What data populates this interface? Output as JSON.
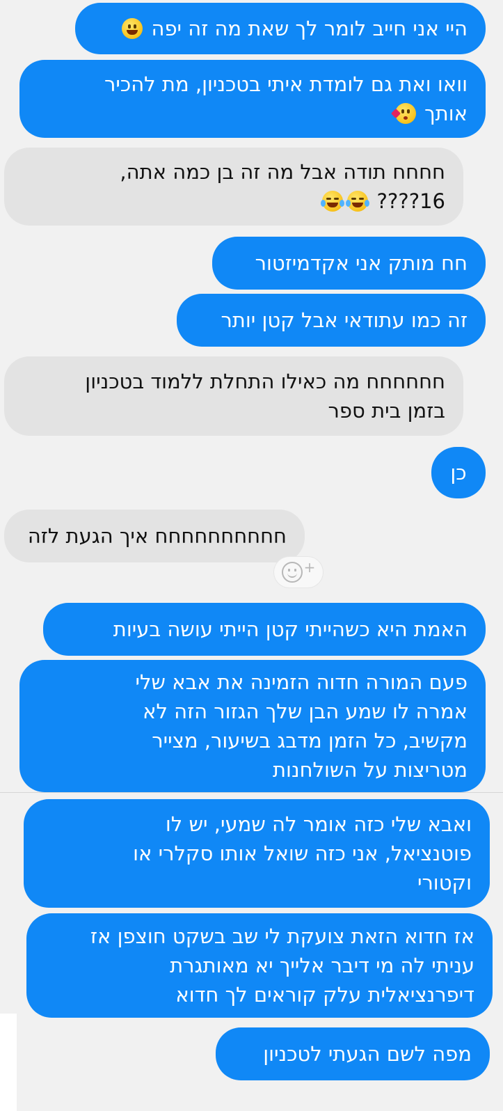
{
  "messages": [
    {
      "side": "out",
      "lines": [
        "היי אני חייב לומר לך שאת מה זה יפה"
      ],
      "emoji": "grinning-face"
    },
    {
      "side": "out",
      "lines": [
        "וואו ואת גם לומדת איתי בטכניון, מת להכיר",
        "אותך"
      ],
      "emoji": "face-blowing-kiss"
    },
    {
      "side": "in",
      "lines": [
        "חחחח תודה אבל מה זה בן כמה אתה,",
        "16????"
      ],
      "emoji": "tears-of-joy"
    },
    {
      "side": "out",
      "lines": [
        "חח מותק אני אקדמיזטור"
      ]
    },
    {
      "side": "out",
      "lines": [
        "זה כמו עתודאי אבל קטן יותר"
      ]
    },
    {
      "side": "in",
      "lines": [
        "חחחחחח מה כאילו התחלת ללמוד בטכניון",
        "בזמן בית ספר"
      ]
    },
    {
      "side": "out",
      "lines": [
        "כן"
      ]
    },
    {
      "side": "in",
      "lines": [
        "חחחחחחחחחח איך הגעת לזה"
      ]
    },
    {
      "side": "out",
      "lines": [
        "האמת היא כשהייתי קטן הייתי עושה בעיות"
      ]
    },
    {
      "side": "out",
      "lines": [
        "פעם המורה חדוה הזמינה את אבא שלי",
        "אמרה לו שמע הבן שלך הגזור הזה לא",
        "מקשיב, כל הזמן מדבג בשיעור, מצייר",
        "מטריצות על השולחנות"
      ]
    },
    {
      "side": "out",
      "lines": [
        "ואבא שלי כזה אומר לה שמעי, יש לו",
        "פוטנציאל, אני כזה שואל אותו סקלרי או",
        "וקטורי"
      ]
    },
    {
      "side": "out",
      "lines": [
        "אז חדוא הזאת צועקת לי שב בשקט חוצפן אז",
        "עניתי לה מי דיבר אלייך יא מאותגרת",
        "דיפרנציאלית עלק קוראים לך חדוא"
      ]
    },
    {
      "side": "out",
      "lines": [
        "מפה לשם הגעתי לטכניון"
      ]
    }
  ],
  "react_button": {
    "icon": "add-reaction-icon",
    "label": "+"
  },
  "colors": {
    "outgoing": "#1088f6",
    "incoming": "#e3e3e3",
    "background": "#f1f1f1"
  }
}
